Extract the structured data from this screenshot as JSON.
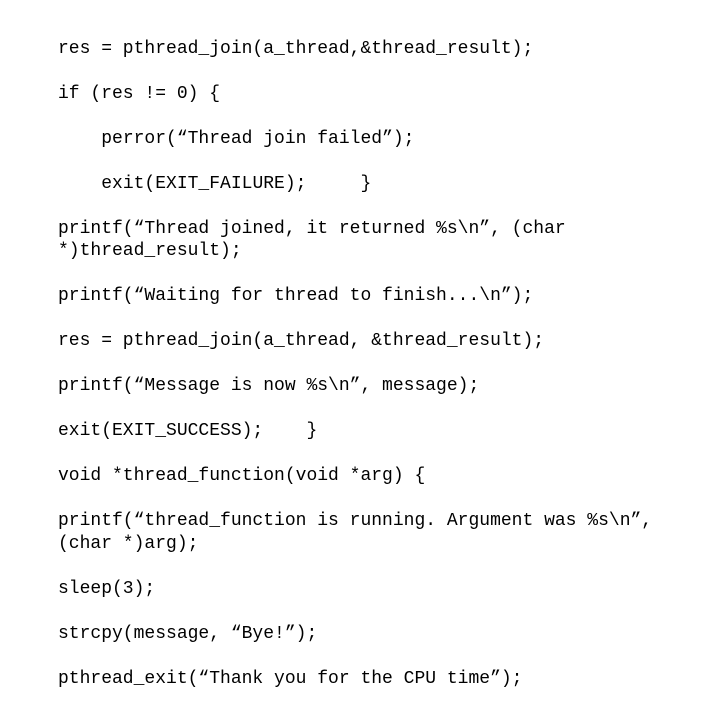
{
  "code": {
    "lines": [
      "res = pthread_join(a_thread,&thread_result);",
      "if (res != 0) {",
      "    perror(“Thread join failed”);",
      "    exit(EXIT_FAILURE);     }",
      "printf(“Thread joined, it returned %s\\n”, (char *)thread_result);",
      "printf(“Waiting for thread to finish...\\n”);",
      "res = pthread_join(a_thread, &thread_result);",
      "printf(“Message is now %s\\n”, message);",
      "exit(EXIT_SUCCESS);    }",
      "void *thread_function(void *arg) {",
      "printf(“thread_function is running. Argument was %s\\n”, (char *)arg);",
      "sleep(3);",
      "strcpy(message, “Bye!”);",
      "pthread_exit(“Thank you for the CPU time”);"
    ]
  }
}
